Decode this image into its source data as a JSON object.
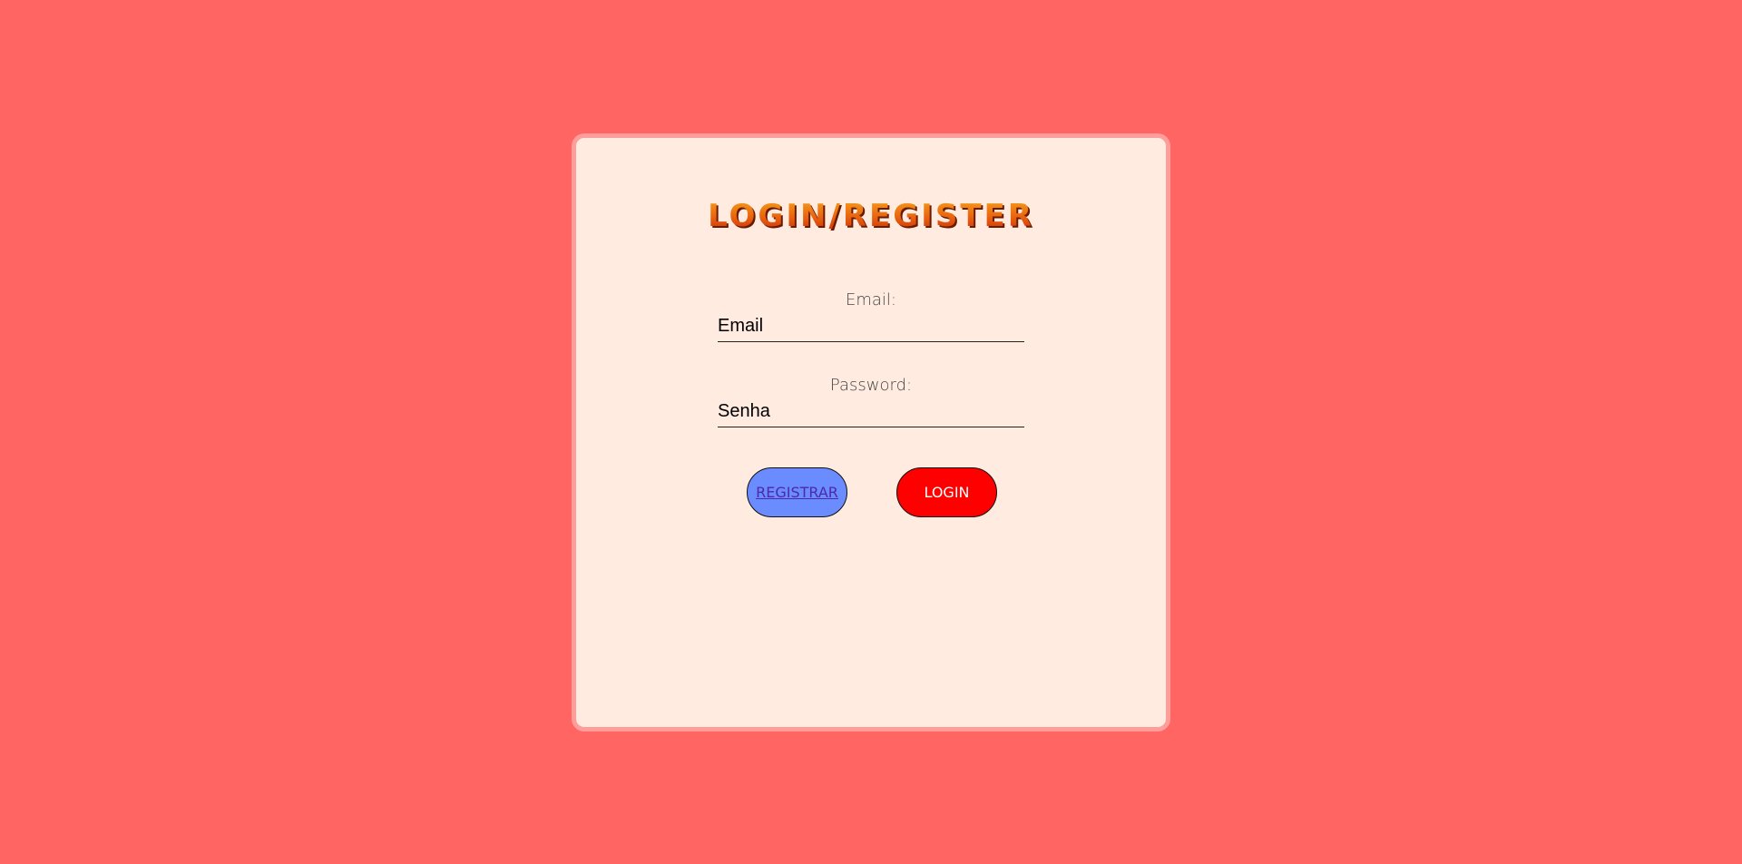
{
  "page": {
    "background_color": "#ff6663"
  },
  "card": {
    "title": "LOGIN/REGISTER",
    "email": {
      "label": "Email:",
      "placeholder": "Email"
    },
    "password": {
      "label": "Password:",
      "placeholder": "Senha"
    },
    "buttons": {
      "register_label": "REGISTRAR",
      "login_label": "LOGIN"
    }
  },
  "colors": {
    "card_background": "#ffebdf",
    "card_border": "#ff9d9b",
    "register_button": "#6b8cff",
    "login_button": "#ff0000",
    "title_gradient_top": "#f7a21a",
    "title_gradient_bottom": "#c92a0a"
  }
}
